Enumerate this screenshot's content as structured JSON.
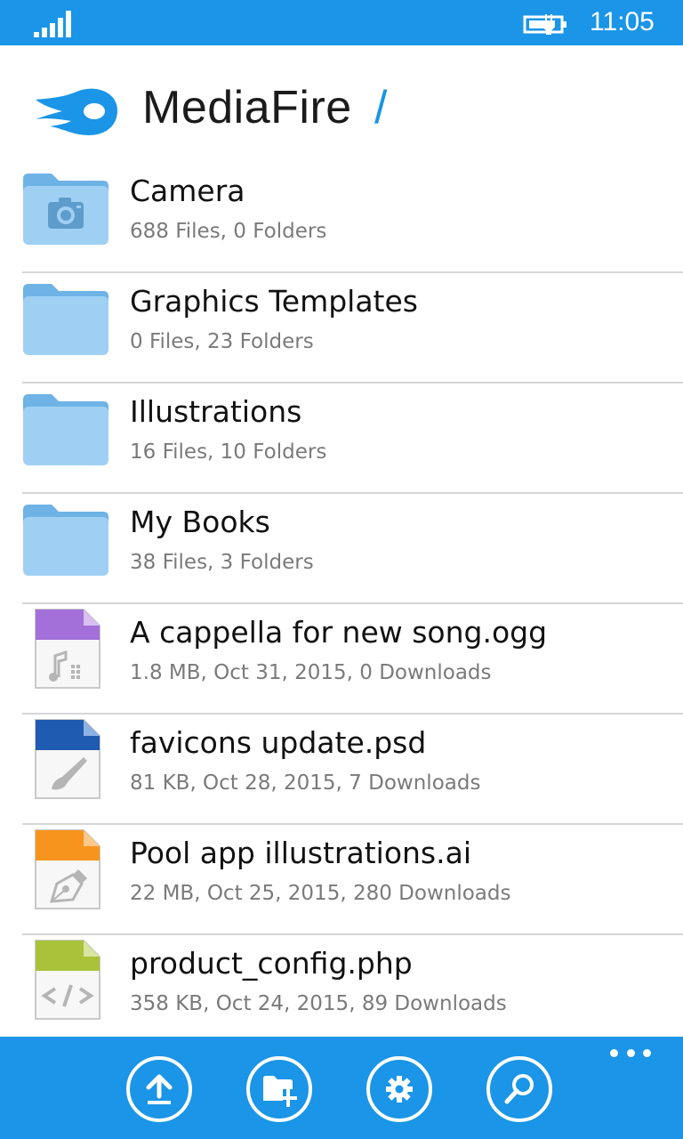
{
  "status_bar": {
    "time": "11:05"
  },
  "header": {
    "app_name": "MediaFire",
    "path_separator": "/"
  },
  "items": [
    {
      "name": "Camera",
      "meta": "688 Files, 0 Folders",
      "icon": "camera-folder-icon"
    },
    {
      "name": "Graphics Templates",
      "meta": "0 Files, 23 Folders",
      "icon": "folder-icon"
    },
    {
      "name": "Illustrations",
      "meta": "16 Files, 10 Folders",
      "icon": "folder-icon"
    },
    {
      "name": "My Books",
      "meta": "38 Files, 3 Folders",
      "icon": "folder-icon"
    },
    {
      "name": "A cappella for new song.ogg",
      "meta": "1.8 MB, Oct 31, 2015, 0 Downloads",
      "icon": "audio-file-icon"
    },
    {
      "name": "favicons update.psd",
      "meta": "81 KB, Oct 28, 2015, 7 Downloads",
      "icon": "image-file-icon"
    },
    {
      "name": "Pool app illustrations.ai",
      "meta": "22 MB, Oct 25, 2015, 280 Downloads",
      "icon": "vector-file-icon"
    },
    {
      "name": "product_config.php",
      "meta": "358 KB, Oct 24, 2015, 89 Downloads",
      "icon": "code-file-icon"
    }
  ],
  "app_bar": {
    "buttons": [
      "upload",
      "new-folder",
      "settings",
      "search"
    ],
    "more": "more-options"
  },
  "colors": {
    "accent": "#1a95e7",
    "folder": "#9fd0f3",
    "audio": "#a36fd8",
    "psd": "#1f5bb0",
    "ai": "#f7941d",
    "php": "#a9c23a"
  }
}
